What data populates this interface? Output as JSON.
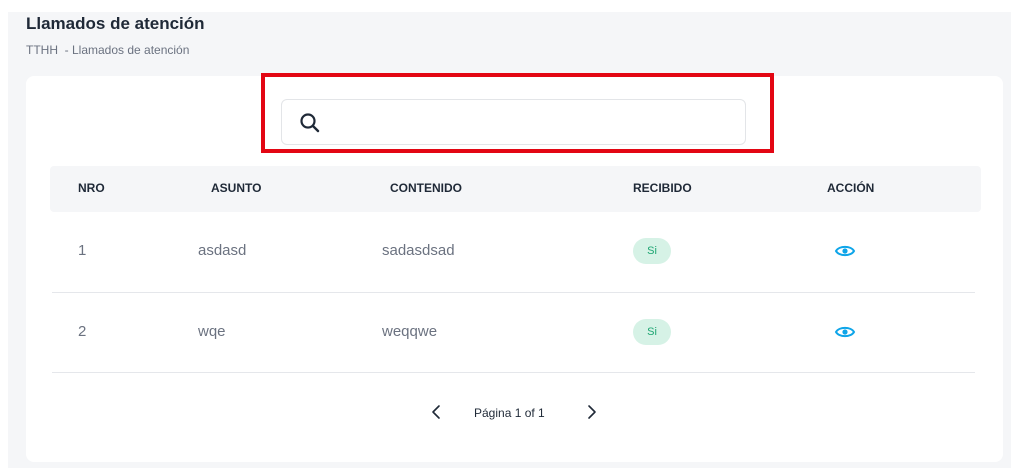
{
  "header": {
    "title": "Llamados de atención",
    "breadcrumb": "TTHH  - Llamados de atención"
  },
  "search": {
    "value": "",
    "placeholder": "",
    "icon": "search-icon"
  },
  "table": {
    "columns": [
      "NRO",
      "ASUNTO",
      "CONTENIDO",
      "RECIBIDO",
      "ACCIÓN"
    ],
    "rows": [
      {
        "nro": "1",
        "asunto": "asdasd",
        "contenido": "sadasdsad",
        "recibido": "Si",
        "action_icon": "eye-icon"
      },
      {
        "nro": "2",
        "asunto": "wqe",
        "contenido": "weqqwe",
        "recibido": "Si",
        "action_icon": "eye-icon"
      }
    ]
  },
  "pagination": {
    "label": "Página 1 of 1",
    "prev_icon": "chevron-left-icon",
    "next_icon": "chevron-right-icon"
  },
  "colors": {
    "highlight": "#e30613",
    "badge_bg": "#d6f2e6",
    "badge_text": "#1ea672",
    "action": "#0ea5e9",
    "page_bg": "#f5f6f8"
  }
}
